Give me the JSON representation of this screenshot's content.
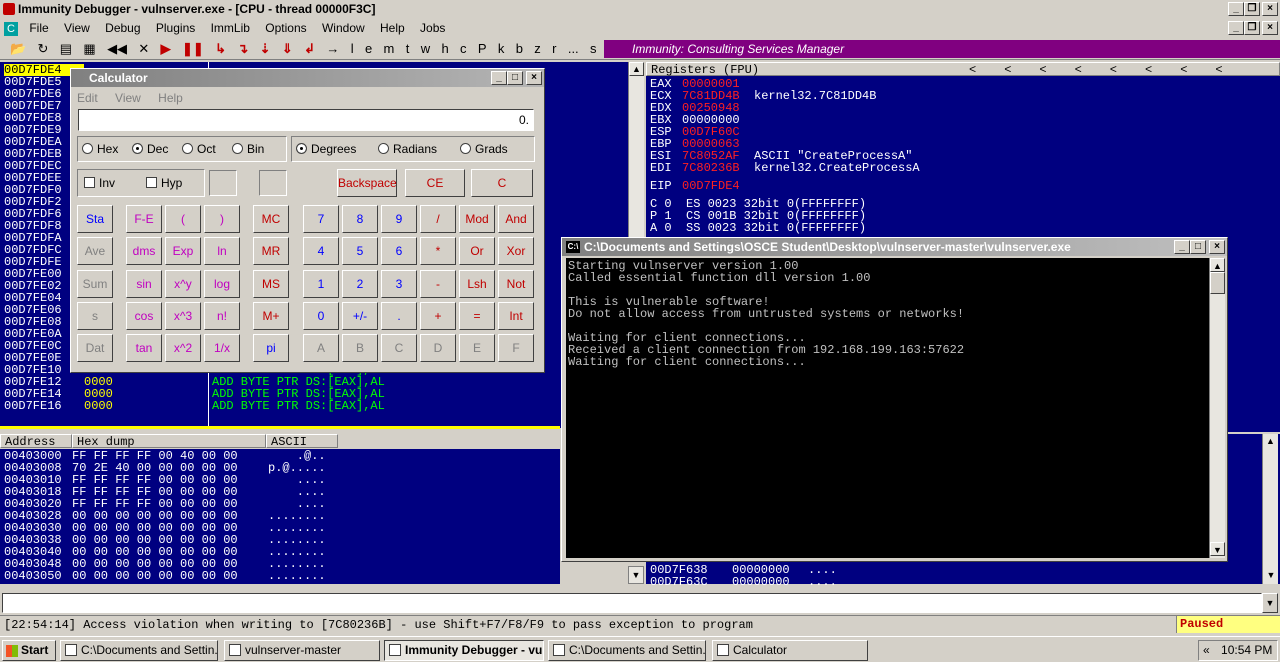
{
  "window": {
    "title": "Immunity Debugger - vulnserver.exe - [CPU - thread 00000F3C]"
  },
  "menu": [
    "File",
    "View",
    "Debug",
    "Plugins",
    "ImmLib",
    "Options",
    "Window",
    "Help",
    "Jobs"
  ],
  "toolbar": {
    "letters": [
      "l",
      "e",
      "m",
      "t",
      "w",
      "h",
      "c",
      "P",
      "k",
      "b",
      "z",
      "r",
      "...",
      "s",
      "?"
    ],
    "banner": "Immunity: Consulting Services Manager"
  },
  "cpu": {
    "rows": [
      {
        "addr": "00D7FDE4",
        "hex": "",
        "instr": ""
      },
      {
        "addr": "00D7FDE5",
        "hex": "",
        "instr": ""
      },
      {
        "addr": "00D7FDE6",
        "hex": "",
        "instr": ""
      },
      {
        "addr": "00D7FDE7",
        "hex": "",
        "instr": ""
      },
      {
        "addr": "00D7FDE8",
        "hex": "",
        "instr": ""
      },
      {
        "addr": "00D7FDE9",
        "hex": "",
        "instr": ""
      },
      {
        "addr": "00D7FDEA",
        "hex": "",
        "instr": ""
      },
      {
        "addr": "00D7FDEB",
        "hex": "",
        "instr": ""
      },
      {
        "addr": "00D7FDEC",
        "hex": "",
        "instr": ""
      },
      {
        "addr": "00D7FDEE",
        "hex": "",
        "instr": ""
      },
      {
        "addr": "00D7FDF0",
        "hex": "",
        "instr": ""
      },
      {
        "addr": "00D7FDF2",
        "hex": "",
        "instr": ""
      },
      {
        "addr": "00D7FDF6",
        "hex": "",
        "instr": ""
      },
      {
        "addr": "00D7FDF8",
        "hex": "",
        "instr": ""
      },
      {
        "addr": "00D7FDFA",
        "hex": "",
        "instr": ""
      },
      {
        "addr": "00D7FDFC",
        "hex": "",
        "instr": ""
      },
      {
        "addr": "00D7FDFE",
        "hex": "",
        "instr": ""
      },
      {
        "addr": "00D7FE00",
        "hex": "",
        "instr": ""
      },
      {
        "addr": "00D7FE02",
        "hex": "",
        "instr": ""
      },
      {
        "addr": "00D7FE04",
        "hex": "",
        "instr": ""
      },
      {
        "addr": "00D7FE06",
        "hex": "",
        "instr": ""
      },
      {
        "addr": "00D7FE08",
        "hex": "",
        "instr": ""
      },
      {
        "addr": "00D7FE0A",
        "hex": "",
        "instr": ""
      },
      {
        "addr": "00D7FE0C",
        "hex": "",
        "instr": ""
      },
      {
        "addr": "00D7FE0E",
        "hex": "",
        "instr": ""
      },
      {
        "addr": "00D7FE10",
        "hex": "0000",
        "instr": "ADD BYTE PTR DS:[EAX],AL"
      },
      {
        "addr": "00D7FE12",
        "hex": "0000",
        "instr": "ADD BYTE PTR DS:[EAX],AL"
      },
      {
        "addr": "00D7FE14",
        "hex": "0000",
        "instr": "ADD BYTE PTR DS:[EAX],AL"
      },
      {
        "addr": "00D7FE16",
        "hex": "0000",
        "instr": "ADD BYTE PTR DS:[EAX],AL"
      }
    ]
  },
  "registers": {
    "header": "Registers (FPU)",
    "rows": [
      {
        "name": "EAX",
        "value": "00000001",
        "comment": "",
        "red": true
      },
      {
        "name": "ECX",
        "value": "7C81DD4B",
        "comment": "kernel32.7C81DD4B",
        "red": true
      },
      {
        "name": "EDX",
        "value": "00250948",
        "comment": "",
        "red": true
      },
      {
        "name": "EBX",
        "value": "00000000",
        "comment": "",
        "red": false
      },
      {
        "name": "ESP",
        "value": "00D7F60C",
        "comment": "",
        "red": true
      },
      {
        "name": "EBP",
        "value": "00000063",
        "comment": "",
        "red": true
      },
      {
        "name": "ESI",
        "value": "7C8052AF",
        "comment": "ASCII \"CreateProcessA\"",
        "red": true
      },
      {
        "name": "EDI",
        "value": "7C80236B",
        "comment": "kernel32.CreateProcessA",
        "red": true
      }
    ],
    "eip_name": "EIP",
    "eip": "00D7FDE4",
    "flags": [
      "C 0  ES 0023 32bit 0(FFFFFFFF)",
      "P 1  CS 001B 32bit 0(FFFFFFFF)",
      "A 0  SS 0023 32bit 0(FFFFFFFF)"
    ]
  },
  "dump": {
    "headers": [
      "Address",
      "Hex dump",
      "ASCII"
    ],
    "rows": [
      {
        "addr": "00403000",
        "hex": "FF FF FF FF 00 40 00 00",
        "ascii": "    .@.."
      },
      {
        "addr": "00403008",
        "hex": "70 2E 40 00 00 00 00 00",
        "ascii": "p.@....."
      },
      {
        "addr": "00403010",
        "hex": "FF FF FF FF 00 00 00 00",
        "ascii": "    ...."
      },
      {
        "addr": "00403018",
        "hex": "FF FF FF FF 00 00 00 00",
        "ascii": "    ...."
      },
      {
        "addr": "00403020",
        "hex": "FF FF FF FF 00 00 00 00",
        "ascii": "    ...."
      },
      {
        "addr": "00403028",
        "hex": "00 00 00 00 00 00 00 00",
        "ascii": "........"
      },
      {
        "addr": "00403030",
        "hex": "00 00 00 00 00 00 00 00",
        "ascii": "........"
      },
      {
        "addr": "00403038",
        "hex": "00 00 00 00 00 00 00 00",
        "ascii": "........"
      },
      {
        "addr": "00403040",
        "hex": "00 00 00 00 00 00 00 00",
        "ascii": "........"
      },
      {
        "addr": "00403048",
        "hex": "00 00 00 00 00 00 00 00",
        "ascii": "........"
      },
      {
        "addr": "00403050",
        "hex": "00 00 00 00 00 00 00 00",
        "ascii": "........"
      }
    ]
  },
  "stack": {
    "rows": [
      {
        "addr": "00D7F638",
        "value": "00000000",
        "ascii": "...."
      },
      {
        "addr": "00D7F63C",
        "value": "00000000",
        "ascii": "...."
      }
    ]
  },
  "calculator": {
    "title": "Calculator",
    "menu": [
      "Edit",
      "View",
      "Help"
    ],
    "display": "0.",
    "bases": [
      "Hex",
      "Dec",
      "Oct",
      "Bin"
    ],
    "angles": [
      "Degrees",
      "Radians",
      "Grads"
    ],
    "checks": [
      "Inv",
      "Hyp"
    ],
    "edit_buttons": [
      "Backspace",
      "CE",
      "C"
    ],
    "left_col": [
      "Sta",
      "Ave",
      "Sum",
      "s",
      "Dat"
    ],
    "sci": [
      [
        "F-E",
        "(",
        ")"
      ],
      [
        "dms",
        "Exp",
        "ln"
      ],
      [
        "sin",
        "x^y",
        "log"
      ],
      [
        "cos",
        "x^3",
        "n!"
      ],
      [
        "tan",
        "x^2",
        "1/x"
      ]
    ],
    "mem": [
      "MC",
      "MR",
      "MS",
      "M+",
      "pi"
    ],
    "digits": [
      [
        "7",
        "8",
        "9",
        "/",
        "Mod",
        "And"
      ],
      [
        "4",
        "5",
        "6",
        "*",
        "Or",
        "Xor"
      ],
      [
        "1",
        "2",
        "3",
        "-",
        "Lsh",
        "Not"
      ],
      [
        "0",
        "+/-",
        ".",
        "+",
        "=",
        "Int"
      ],
      [
        "A",
        "B",
        "C",
        "D",
        "E",
        "F"
      ]
    ]
  },
  "console": {
    "title": "C:\\Documents and Settings\\OSCE Student\\Desktop\\vulnserver-master\\vulnserver.exe",
    "lines": [
      "Starting vulnserver version 1.00",
      "Called essential function dll version 1.00",
      "",
      "This is vulnerable software!",
      "Do not allow access from untrusted systems or networks!",
      "",
      "Waiting for client connections...",
      "Received a client connection from 192.168.199.163:57622",
      "Waiting for client connections..."
    ]
  },
  "status": {
    "message": "[22:54:14] Access violation when writing to [7C80236B] - use Shift+F7/F8/F9 to pass exception to program",
    "state": "Paused"
  },
  "taskbar": {
    "start": "Start",
    "items": [
      {
        "label": "C:\\Documents and Settin...",
        "active": false
      },
      {
        "label": "vulnserver-master",
        "active": false
      },
      {
        "label": "Immunity Debugger - vul...",
        "active": true
      },
      {
        "label": "C:\\Documents and Settin...",
        "active": false
      },
      {
        "label": "Calculator",
        "active": false
      }
    ],
    "clock": "10:54 PM"
  }
}
